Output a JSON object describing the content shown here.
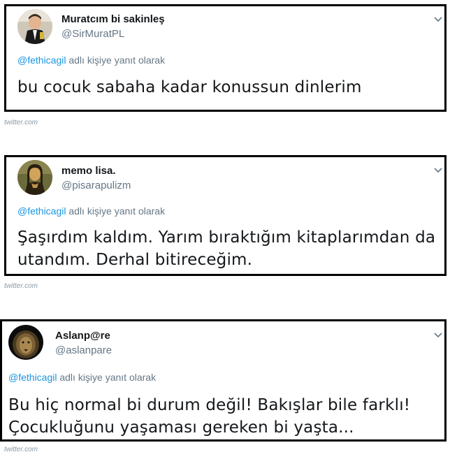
{
  "source_label": "twitter.com",
  "reply_suffix": "adlı kişiye yanıt olarak",
  "reply_to": "@fethicagil",
  "link_color": "#1b95e0",
  "tweets": [
    {
      "display_name": "Muratcım bi sakinleş",
      "handle": "@SirMuratPL",
      "text": "bu cocuk sabaha kadar konussun dinlerim",
      "avatar_icon": "child-photo-avatar"
    },
    {
      "display_name": "memo lisa.",
      "handle": "@pisarapulizm",
      "text_lines": [
        "Şaşırdım kaldım. Yarım bıraktığım kitaplarımdan da",
        "utandım. Derhal bitireceğim."
      ],
      "avatar_icon": "mona-lisa-avatar"
    },
    {
      "display_name": "Aslanp@re",
      "handle": "@aslanpare",
      "text_lines": [
        "Bu hiç normal bi durum değil! Bakışlar bile farklı!",
        "Çocukluğunu yaşaması gereken bi yaşta..."
      ],
      "avatar_icon": "lion-avatar"
    }
  ]
}
